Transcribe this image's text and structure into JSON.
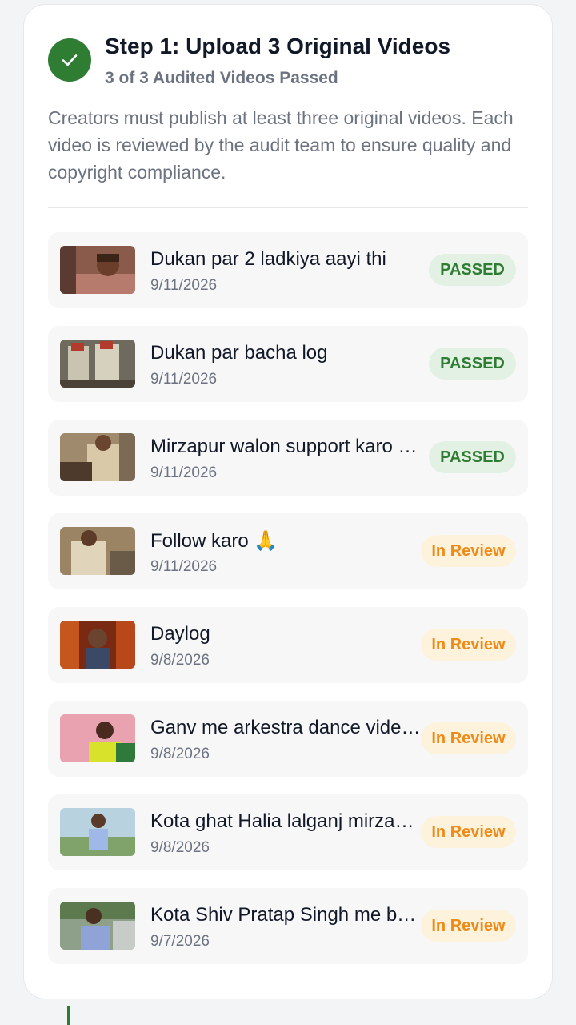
{
  "step": {
    "title": "Step 1: Upload 3 Original Videos",
    "subtitle": "3 of 3 Audited Videos Passed",
    "description": "Creators must publish at least three original videos. Each video is reviewed by the audit team to ensure quality and copyright compliance."
  },
  "videos": [
    {
      "title": "Dukan par 2 ladkiya aayi thi",
      "date": "9/11/2026",
      "status": "PASSED"
    },
    {
      "title": "Dukan par bacha log",
      "date": "9/11/2026",
      "status": "PASSED"
    },
    {
      "title": "Mirzapur walon support karo …",
      "date": "9/11/2026",
      "status": "PASSED"
    },
    {
      "title": "Follow karo 🙏",
      "date": "9/11/2026",
      "status": "In Review"
    },
    {
      "title": "Daylog",
      "date": "9/8/2026",
      "status": "In Review"
    },
    {
      "title": "Ganv me arkestra dance vide…",
      "date": "9/8/2026",
      "status": "In Review"
    },
    {
      "title": "Kota ghat Halia lalganj mirza…",
      "date": "9/8/2026",
      "status": "In Review"
    },
    {
      "title": "Kota Shiv Pratap Singh me b…",
      "date": "9/7/2026",
      "status": "In Review"
    }
  ],
  "colors": {
    "accent_green": "#2e7d32",
    "passed_bg": "#e3f1e4",
    "review_text": "#ef8a16",
    "review_bg": "#fdf3dd"
  },
  "icons": {
    "step_status": "check-icon"
  }
}
